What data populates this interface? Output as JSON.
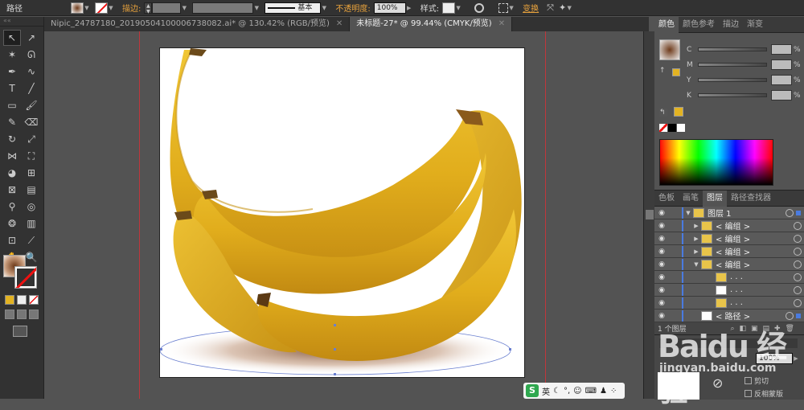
{
  "control_bar": {
    "object_label": "路径",
    "stroke_label": "描边:",
    "stroke_profile": "基本",
    "opacity_label": "不透明度:",
    "opacity_value": "100%",
    "style_label": "样式:",
    "transform_label": "变换"
  },
  "doc_tabs": [
    {
      "label": "Nipic_24787180_20190504100006738082.ai* @ 130.42% (RGB/预览)",
      "active": false
    },
    {
      "label": "未标题-27* @ 99.44% (CMYK/预览)",
      "active": true
    }
  ],
  "color_panel": {
    "tabs": [
      "颜色",
      "颜色参考",
      "描边",
      "渐变"
    ],
    "channels": [
      {
        "label": "C",
        "unit": "%"
      },
      {
        "label": "M",
        "unit": "%"
      },
      {
        "label": "Y",
        "unit": "%"
      },
      {
        "label": "K",
        "unit": "%"
      }
    ]
  },
  "layers_panel": {
    "tabs": [
      "色板",
      "画笔",
      "图层",
      "路径查找器"
    ],
    "rows": [
      {
        "name": "图层 1",
        "level": 0,
        "expanded": true
      },
      {
        "name": "< 编组 >",
        "level": 1,
        "expanded": false
      },
      {
        "name": "< 编组 >",
        "level": 1,
        "expanded": false
      },
      {
        "name": "< 编组 >",
        "level": 1,
        "expanded": false
      },
      {
        "name": "< 编组 >",
        "level": 1,
        "expanded": true
      },
      {
        "name": ". . .",
        "level": 2
      },
      {
        "name": ". . .",
        "level": 2
      },
      {
        "name": ". . .",
        "level": 2
      },
      {
        "name": "< 路径 >",
        "level": 1
      }
    ],
    "footer": "1 个图层"
  },
  "transparency": {
    "value": "100%",
    "clip_label": "剪切",
    "invert_label": "反相蒙版"
  },
  "ime": {
    "lang": "英"
  },
  "watermark": {
    "logo": "Baidu 经验",
    "url": "jingyan.baidu.com"
  },
  "colors": {
    "banana": "#e3b322",
    "guide": "#c0363b",
    "layer_accent": "#4a7be0"
  }
}
